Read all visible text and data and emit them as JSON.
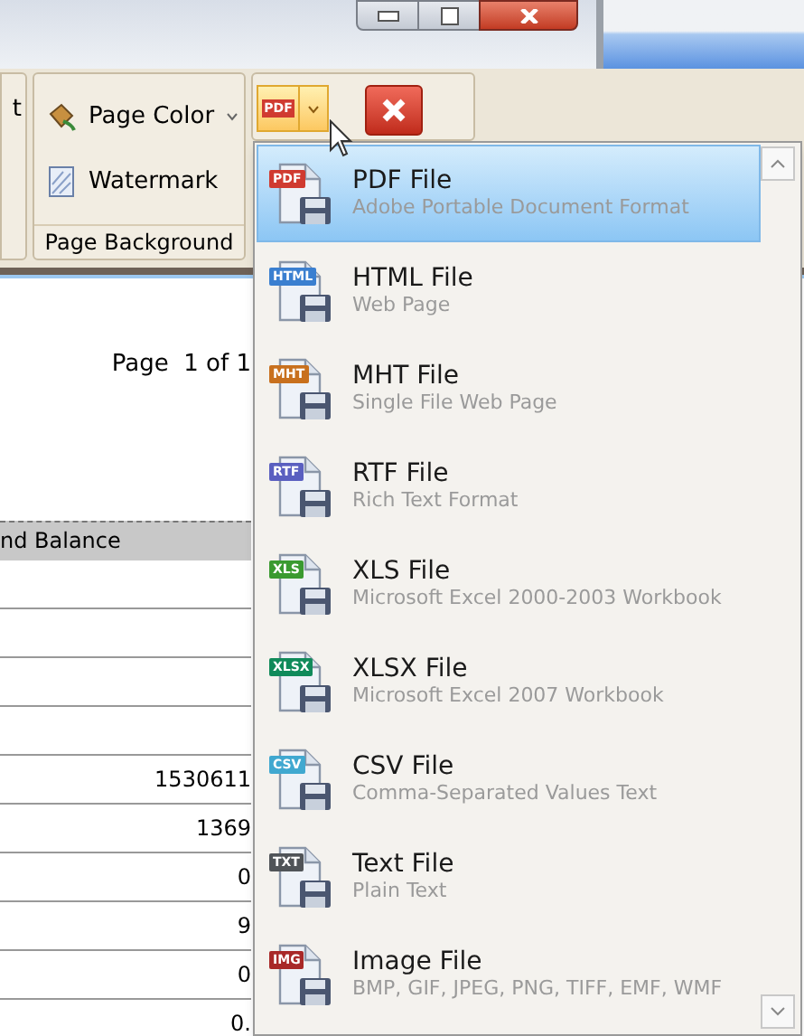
{
  "ribbon": {
    "cut_label": "t",
    "page_color": "Page Color",
    "watermark": "Watermark",
    "group_label": "Page Background",
    "export_button": {
      "tag": "PDF",
      "expanded": true
    }
  },
  "document": {
    "page_label": "Page  1 of 1",
    "column_header": "nd Balance",
    "rows": [
      {
        "kind": "empty"
      },
      {
        "kind": "empty"
      },
      {
        "kind": "empty"
      },
      {
        "kind": "empty"
      },
      {
        "kind": "value",
        "value": "1530611"
      },
      {
        "kind": "value",
        "value": "1369"
      },
      {
        "kind": "value",
        "value": "0"
      },
      {
        "kind": "value",
        "value": "9"
      },
      {
        "kind": "value",
        "value": "0"
      },
      {
        "kind": "value",
        "value": "0."
      }
    ]
  },
  "export_menu": {
    "items": [
      {
        "title": "PDF File",
        "subtitle": "Adobe Portable Document Format",
        "tag": "PDF",
        "color": "#d03a30",
        "selected": true
      },
      {
        "title": "HTML File",
        "subtitle": "Web Page",
        "tag": "HTML",
        "color": "#3a7fd0",
        "selected": false
      },
      {
        "title": "MHT File",
        "subtitle": "Single File Web Page",
        "tag": "MHT",
        "color": "#c8701e",
        "selected": false
      },
      {
        "title": "RTF File",
        "subtitle": "Rich Text Format",
        "tag": "RTF",
        "color": "#5a5fc0",
        "selected": false
      },
      {
        "title": "XLS File",
        "subtitle": "Microsoft Excel 2000-2003 Workbook",
        "tag": "XLS",
        "color": "#3a9a30",
        "selected": false
      },
      {
        "title": "XLSX File",
        "subtitle": "Microsoft Excel 2007 Workbook",
        "tag": "XLSX",
        "color": "#108a5a",
        "selected": false
      },
      {
        "title": "CSV File",
        "subtitle": "Comma-Separated Values Text",
        "tag": "CSV",
        "color": "#40a8d0",
        "selected": false
      },
      {
        "title": "Text File",
        "subtitle": "Plain Text",
        "tag": "TXT",
        "color": "#505458",
        "selected": false
      },
      {
        "title": "Image File",
        "subtitle": "BMP, GIF, JPEG, PNG, TIFF, EMF, WMF",
        "tag": "IMG",
        "color": "#a82828",
        "selected": false
      }
    ]
  }
}
